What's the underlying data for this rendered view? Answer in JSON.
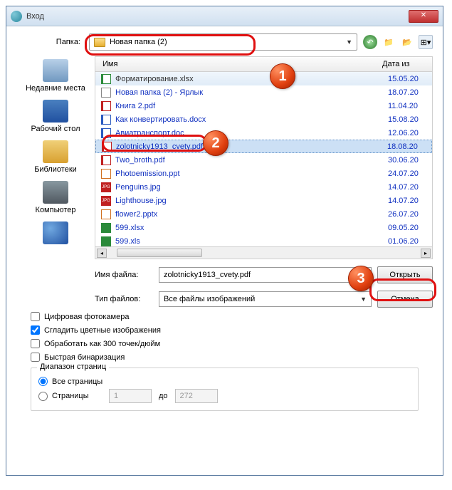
{
  "window": {
    "title": "Вход"
  },
  "folder": {
    "label": "Папка:",
    "current": "Новая папка (2)"
  },
  "headers": {
    "name": "Имя",
    "date": "Дата из"
  },
  "places": {
    "recent": "Недавние места",
    "desktop": "Рабочий стол",
    "libraries": "Библиотеки",
    "computer": "Компьютер"
  },
  "files": [
    {
      "icon": "xlsx",
      "name": "Форматирование.xlsx",
      "date": "15.05.20",
      "header": false
    },
    {
      "icon": "lnk",
      "name": "Новая папка (2) - Ярлык",
      "date": "18.07.20"
    },
    {
      "icon": "pdf",
      "name": "Книга 2.pdf",
      "date": "11.04.20"
    },
    {
      "icon": "docx",
      "name": "Как конвертировать.docx",
      "date": "15.08.20"
    },
    {
      "icon": "doc",
      "name": "Авиатранспорт.doc",
      "date": "12.06.20"
    },
    {
      "icon": "pdf",
      "name": "zolotnicky1913_cvety.pdf",
      "date": "18.08.20",
      "selected": true
    },
    {
      "icon": "pdf",
      "name": "Two_broth.pdf",
      "date": "30.06.20"
    },
    {
      "icon": "ppt",
      "name": "Photoemission.ppt",
      "date": "24.07.20"
    },
    {
      "icon": "jpg",
      "name": "Penguins.jpg",
      "date": "14.07.20"
    },
    {
      "icon": "jpg",
      "name": "Lighthouse.jpg",
      "date": "14.07.20"
    },
    {
      "icon": "pptx",
      "name": "flower2.pptx",
      "date": "26.07.20"
    },
    {
      "icon": "xls",
      "name": "599.xlsx",
      "date": "09.05.20"
    },
    {
      "icon": "xls",
      "name": "599.xls",
      "date": "01.06.20"
    }
  ],
  "filename": {
    "label": "Имя файла:",
    "value": "zolotnicky1913_cvety.pdf"
  },
  "filetype": {
    "label": "Тип файлов:",
    "value": "Все файлы изображений"
  },
  "buttons": {
    "open": "Открыть",
    "cancel": "Отмена"
  },
  "options": {
    "camera": "Цифровая фотокамера",
    "smooth": "Сгладить цветные изображения",
    "dpi300": "Обработать как 300 точек/дюйм",
    "fastbin": "Быстрая бинаризация"
  },
  "range": {
    "legend": "Диапазон страниц",
    "all": "Все страницы",
    "pages": "Страницы",
    "from": "1",
    "to_label": "до",
    "to": "272"
  }
}
